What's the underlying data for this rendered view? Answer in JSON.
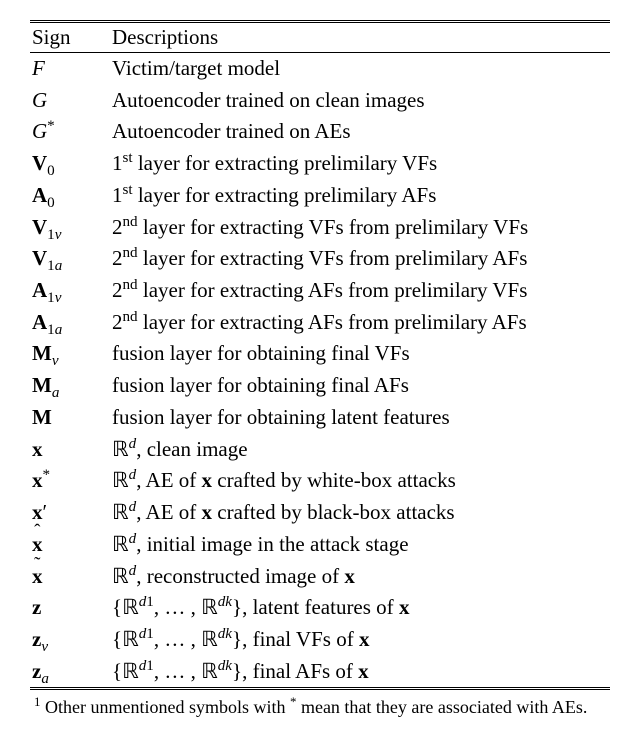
{
  "headers": {
    "sign": "Sign",
    "desc": "Descriptions"
  },
  "rows": [
    {
      "sign_html": "<span class='cal'>F</span>",
      "desc": "Victim/target model"
    },
    {
      "sign_html": "<span class='cal'>G</span>",
      "desc": "Autoencoder trained on clean images"
    },
    {
      "sign_html": "<span class='cal'>G</span><sup>*</sup>",
      "desc": "Autoencoder trained on AEs"
    },
    {
      "sign_html": "<span class='bf'>V</span><sub>0</sub>",
      "desc_html": "1<sup>st</sup> layer for extracting prelimilary VFs"
    },
    {
      "sign_html": "<span class='bf'>A</span><sub>0</sub>",
      "desc_html": "1<sup>st</sup> layer for extracting prelimilary AFs"
    },
    {
      "sign_html": "<span class='bf'>V</span><sub>1<i>v</i></sub>",
      "desc_html": "2<sup>nd</sup> layer for extracting VFs from prelimilary VFs"
    },
    {
      "sign_html": "<span class='bf'>V</span><sub>1<i>a</i></sub>",
      "desc_html": "2<sup>nd</sup> layer for extracting VFs from prelimilary AFs"
    },
    {
      "sign_html": "<span class='bf'>A</span><sub>1<i>v</i></sub>",
      "desc_html": "2<sup>nd</sup> layer for extracting AFs from prelimilary VFs"
    },
    {
      "sign_html": "<span class='bf'>A</span><sub>1<i>a</i></sub>",
      "desc_html": "2<sup>nd</sup> layer for extracting AFs from prelimilary AFs"
    },
    {
      "sign_html": "<span class='bf'>M</span><sub><i>v</i></sub>",
      "desc": "fusion layer for obtaining final VFs"
    },
    {
      "sign_html": "<span class='bf'>M</span><sub><i>a</i></sub>",
      "desc": "fusion layer for obtaining final AFs"
    },
    {
      "sign_html": "<span class='bf'>M</span>",
      "desc": "fusion layer for obtaining latent features"
    },
    {
      "sign_html": "<span class='bf'>x</span>",
      "desc_html": "ℝ<sup><i>d</i></sup>, clean image"
    },
    {
      "sign_html": "<span class='bf'>x</span><sup>*</sup>",
      "desc_html": "ℝ<sup><i>d</i></sup>, AE of <span class='bf'>x</span> crafted by white-box attacks"
    },
    {
      "sign_html": "<span class='bf'>x</span>&#x2032;",
      "desc_html": "ℝ<sup><i>d</i></sup>, AE of <span class='bf'>x</span> crafted by black-box attacks"
    },
    {
      "sign_html": "<span class='hat'><span class='bf'>x</span></span>",
      "desc_html": "ℝ<sup><i>d</i></sup>, initial image in the attack stage"
    },
    {
      "sign_html": "<span class='tilde'><span class='bf'>x</span></span>",
      "desc_html": "ℝ<sup><i>d</i></sup>, reconstructed image of <span class='bf'>x</span>"
    },
    {
      "sign_html": "<span class='bf'>z</span>",
      "desc_html": "{ℝ<sup><i>d</i>1</sup>, … , ℝ<sup><i>dk</i></sup>}, latent features of <span class='bf'>x</span>"
    },
    {
      "sign_html": "<span class='bf'>z</span><sub><i>v</i></sub>",
      "desc_html": "{ℝ<sup><i>d</i>1</sup>, … , ℝ<sup><i>dk</i></sup>}, final VFs of <span class='bf'>x</span>"
    },
    {
      "sign_html": "<span class='bf'>z</span><sub><i>a</i></sub>",
      "desc_html": "{ℝ<sup><i>d</i>1</sup>, … , ℝ<sup><i>dk</i></sup>}, final AFs of <span class='bf'>x</span>"
    }
  ],
  "footnote_html": "<sup>1</sup> Other unmentioned symbols with <sup>*</sup> mean that they are associated with AEs."
}
